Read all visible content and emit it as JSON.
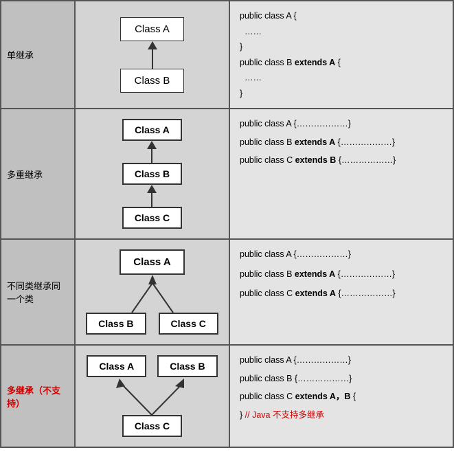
{
  "rows": [
    {
      "id": "single-inheritance",
      "label": "单继承",
      "label_color": "black",
      "diagram_type": "single",
      "classes_in_diagram": [
        "Class A",
        "Class B"
      ],
      "code_lines": [
        {
          "text": "public class A {",
          "bold_parts": []
        },
        {
          "text": "……",
          "bold_parts": []
        },
        {
          "text": "}",
          "bold_parts": []
        },
        {
          "text": "public class B extends A {",
          "bold_parts": [
            "extends A"
          ]
        },
        {
          "text": "……",
          "bold_parts": []
        },
        {
          "text": "}",
          "bold_parts": []
        }
      ]
    },
    {
      "id": "multi-level",
      "label": "多重继承",
      "label_color": "black",
      "diagram_type": "multi-level",
      "classes_in_diagram": [
        "Class A",
        "Class B",
        "Class C"
      ],
      "code_lines": [
        {
          "text": "public class A {………………}",
          "bold_parts": []
        },
        {
          "text": "public class B extends A {………………}",
          "bold_parts": [
            "extends A"
          ]
        },
        {
          "text": "public class C extends B {………………}",
          "bold_parts": [
            "extends B"
          ]
        }
      ]
    },
    {
      "id": "fan-in",
      "label": "不同类继承同一个类",
      "label_color": "black",
      "diagram_type": "fan-in",
      "classes_in_diagram": [
        "Class A",
        "Class B",
        "Class C"
      ],
      "code_lines": [
        {
          "text": "public class A {………………}",
          "bold_parts": []
        },
        {
          "text": "public class B extends A {………………}",
          "bold_parts": [
            "extends A"
          ]
        },
        {
          "text": "public class C extends A {………………}",
          "bold_parts": [
            "extends A"
          ]
        }
      ]
    },
    {
      "id": "multiple-inheritance",
      "label": "多继承（不支持）",
      "label_color": "red",
      "diagram_type": "multi-parent",
      "classes_in_diagram": [
        "Class A",
        "Class B",
        "Class C"
      ],
      "code_lines": [
        {
          "text": "public class A {………………}",
          "bold_parts": []
        },
        {
          "text": "public class B {………………}",
          "bold_parts": []
        },
        {
          "text": "public class C extends A，B {",
          "bold_parts": [
            "extends A，B"
          ]
        },
        {
          "text": "} // Java 不支持多继承",
          "bold_parts": [
            "// Java 不支持多继承"
          ],
          "red_suffix": true
        }
      ]
    }
  ]
}
